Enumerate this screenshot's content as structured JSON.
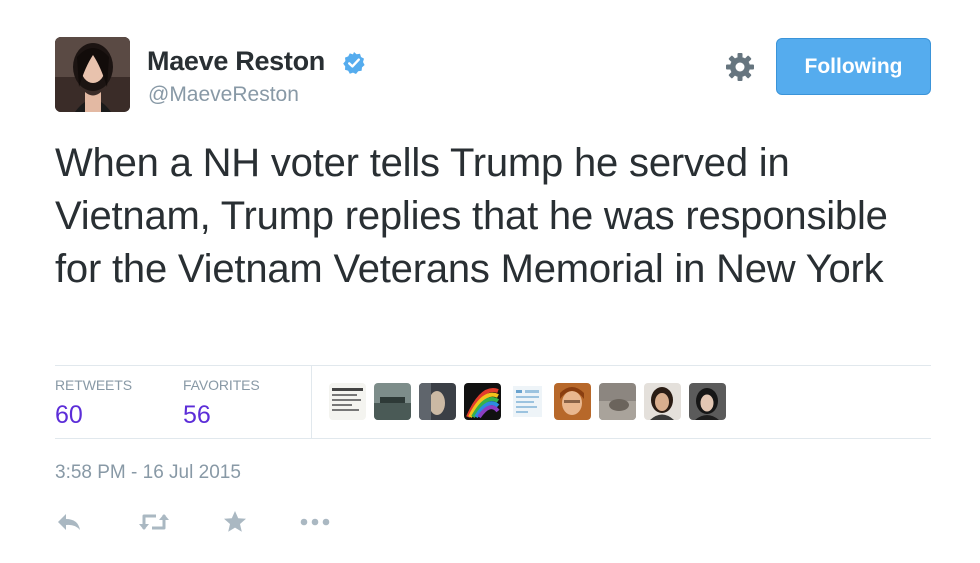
{
  "author": {
    "name": "Maeve Reston",
    "handle": "@MaeveReston",
    "verified": true
  },
  "header": {
    "follow_label": "Following",
    "settings_icon": "gear-icon"
  },
  "tweet": {
    "text": "When a NH voter tells Trump he served in Vietnam, Trump replies that he was responsible for the Vietnam Veterans Memorial in New York"
  },
  "stats": {
    "retweets_label": "RETWEETS",
    "retweets_count": "60",
    "favorites_label": "FAVORITES",
    "favorites_count": "56"
  },
  "favoriters_count_shown": 9,
  "timestamp": "3:58 PM - 16 Jul 2015",
  "actions": {
    "reply_icon": "reply-icon",
    "retweet_icon": "retweet-icon",
    "favorite_icon": "star-icon",
    "more_icon": "more-icon"
  },
  "colors": {
    "accent": "#55acee",
    "stat_number": "#5c2dd8",
    "muted": "#8899a6",
    "text": "#292f33",
    "verified": "#55acee"
  }
}
